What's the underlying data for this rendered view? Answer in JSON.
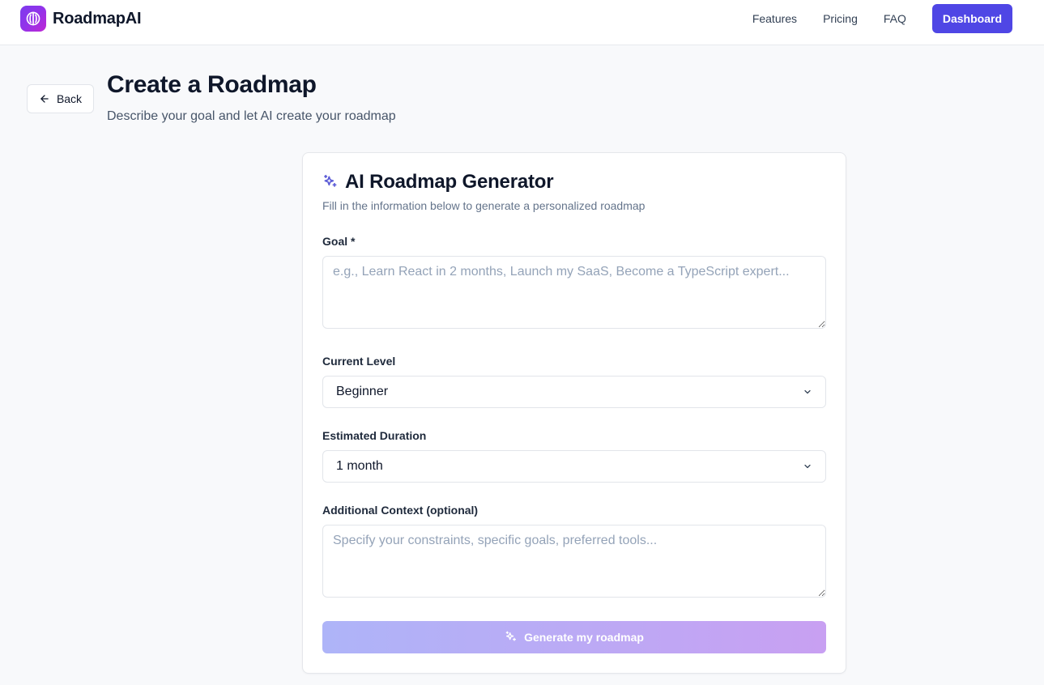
{
  "brand": {
    "name": "RoadmapAI"
  },
  "nav": {
    "links": [
      "Features",
      "Pricing",
      "FAQ"
    ],
    "dashboard_label": "Dashboard"
  },
  "header": {
    "back_label": "Back",
    "title": "Create a Roadmap",
    "subtitle": "Describe your goal and let AI create your roadmap"
  },
  "card": {
    "title": "AI Roadmap Generator",
    "subtitle": "Fill in the information below to generate a personalized roadmap",
    "goal": {
      "label": "Goal *",
      "value": "",
      "placeholder": "e.g., Learn React in 2 months, Launch my SaaS, Become a TypeScript expert..."
    },
    "level": {
      "label": "Current Level",
      "selected": "Beginner"
    },
    "duration": {
      "label": "Estimated Duration",
      "selected": "1 month"
    },
    "context": {
      "label": "Additional Context (optional)",
      "value": "",
      "placeholder": "Specify your constraints, specific goals, preferred tools..."
    },
    "generate_label": "Generate my roadmap"
  },
  "colors": {
    "accent": "#4f46e5",
    "logo_gradient": [
      "#7c3aed",
      "#c026d3"
    ],
    "button_gradient": [
      "#aeb4f8",
      "#c8a0f2"
    ]
  },
  "icons": [
    "brain-icon",
    "arrow-left-icon",
    "sparkles-icon",
    "chevron-down-icon"
  ]
}
